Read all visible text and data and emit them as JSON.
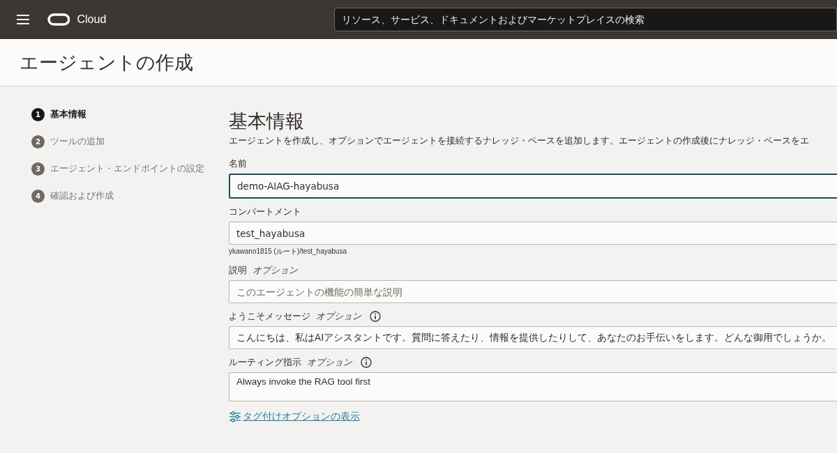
{
  "header": {
    "brand": "Cloud",
    "search": {
      "placeholder": "リソース、サービス、ドキュメントおよびマーケットプレイスの検索"
    }
  },
  "page_title": "エージェントの作成",
  "steps": [
    {
      "number": "1",
      "label": "基本情報",
      "selected": true
    },
    {
      "number": "2",
      "label": "ツールの追加",
      "selected": false
    },
    {
      "number": "3",
      "label": "エージェント・エンドポイントの設定",
      "selected": false
    },
    {
      "number": "4",
      "label": "確認および作成",
      "selected": false
    }
  ],
  "section": {
    "title": "基本情報",
    "description": "エージェントを作成し、オプションでエージェントを接続するナレッジ・ベースを追加します。エージェントの作成後にナレッジ・ベースをエ"
  },
  "fields": [
    {
      "kind": "input",
      "label": "名前",
      "value": "demo-AIAG-hayabusa",
      "focused": true
    },
    {
      "kind": "input",
      "label": "コンパートメント",
      "value": "test_hayabusa",
      "hint": "ykawano1815 (ルート)/test_hayabusa"
    },
    {
      "kind": "input",
      "label": "説明",
      "optional": "オプション",
      "placeholder": "このエージェントの機能の簡単な説明"
    },
    {
      "kind": "input",
      "label": "ようこそメッセージ",
      "optional": "オプション",
      "info": true,
      "value": "こんにちは、私はAIアシスタントです。質問に答えたり、情報を提供したりして、あなたのお手伝いをします。どんな御用でしょうか。"
    },
    {
      "kind": "textarea",
      "label": "ルーティング指示",
      "optional": "オプション",
      "info": true,
      "value": "Always invoke the RAG tool first"
    }
  ],
  "tag_link": "タグ付けオプションの表示"
}
